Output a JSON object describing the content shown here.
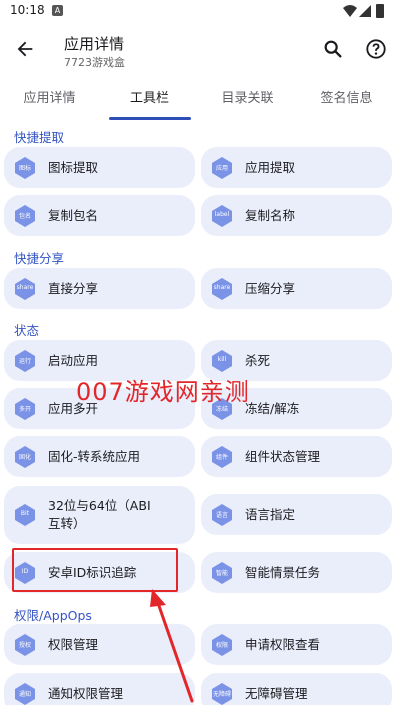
{
  "status": {
    "time": "10:18",
    "notification": "A"
  },
  "header": {
    "title": "应用详情",
    "subtitle": "7723游戏盒"
  },
  "tabs": [
    "应用详情",
    "工具栏",
    "目录关联",
    "签名信息"
  ],
  "sections": {
    "quick_extract": "快捷提取",
    "quick_share": "快捷分享",
    "state": "状态",
    "permissions": "权限/AppOps"
  },
  "items": {
    "icon_extract": {
      "tag": "图标",
      "label": "图标提取"
    },
    "app_extract": {
      "tag": "应用",
      "label": "应用提取"
    },
    "copy_package": {
      "tag": "包名",
      "label": "复制包名"
    },
    "copy_name": {
      "tag": "label",
      "label": "复制名称"
    },
    "direct_share": {
      "tag": "share",
      "label": "直接分享"
    },
    "zip_share": {
      "tag": "share",
      "label": "压缩分享"
    },
    "launch_app": {
      "tag": "运行",
      "label": "启动应用"
    },
    "kill": {
      "tag": "kill",
      "label": "杀死"
    },
    "multi_open": {
      "tag": "多开",
      "label": "应用多开"
    },
    "freeze": {
      "tag": "冻结",
      "label": "冻结/解冻"
    },
    "solidify": {
      "tag": "固化",
      "label": "固化-转系统应用"
    },
    "component_state": {
      "tag": "组件",
      "label": "组件状态管理"
    },
    "abi": {
      "tag": "Bit",
      "label": "32位与64位（ABI互转）"
    },
    "language": {
      "tag": "语言",
      "label": "语言指定"
    },
    "android_id": {
      "tag": "ID",
      "label": "安卓ID标识追踪"
    },
    "smart_scene": {
      "tag": "智能",
      "label": "智能情景任务"
    },
    "perm_manage": {
      "tag": "授权",
      "label": "权限管理"
    },
    "perm_request": {
      "tag": "权限",
      "label": "申请权限查看"
    },
    "notif_perm": {
      "tag": "通知",
      "label": "通知权限管理"
    },
    "accessibility": {
      "tag": "无障碍",
      "label": "无障碍管理"
    }
  },
  "watermark": "007游戏网亲测",
  "colors": {
    "accent": "#3454c4",
    "card": "#eaedfa",
    "icon": "#7b93e6",
    "annotation": "#e2262a"
  }
}
